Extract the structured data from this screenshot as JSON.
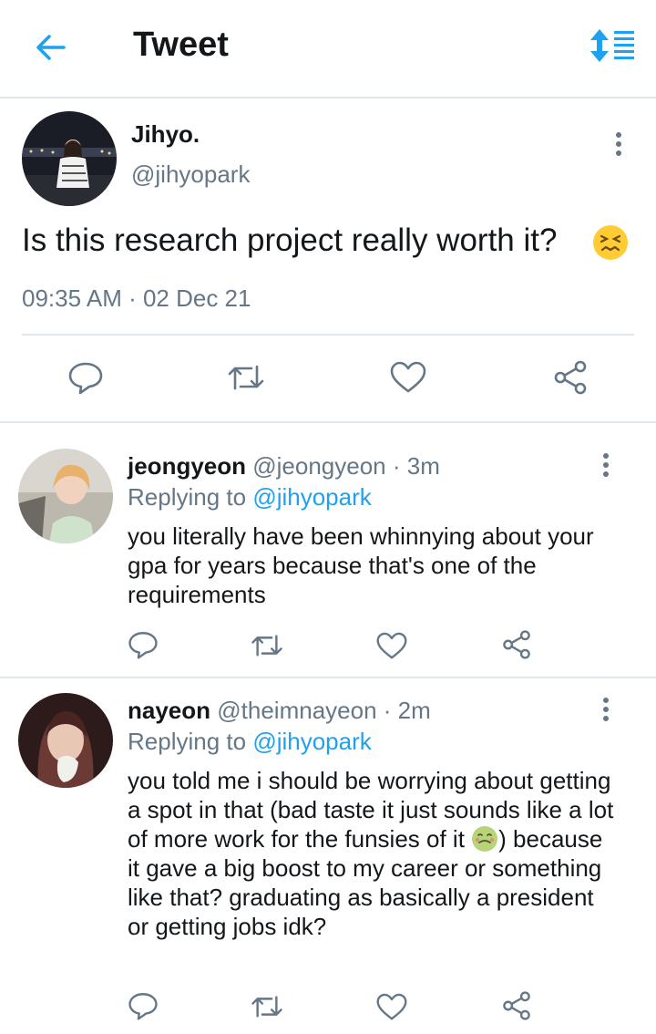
{
  "header": {
    "title": "Tweet",
    "accent_color": "#1da1f2",
    "back_icon": "arrow-left-icon",
    "sort_icon": "sort-list-icon"
  },
  "main_tweet": {
    "name": "Jihyo.",
    "handle": "@jihyopark",
    "text": "Is this research project really worth it?",
    "emoji": "confounded-face-emoji",
    "timestamp": "09:35 AM · 02 Dec 21",
    "actions": [
      "reply-icon",
      "retweet-icon",
      "like-icon",
      "share-icon"
    ]
  },
  "replies": [
    {
      "name": "jeongyeon",
      "handle": "@jeongyeon",
      "time": "· 3m",
      "replying_label": "Replying to",
      "replying_to": "@jihyopark",
      "text": "you literally have been whinnying about your gpa for years because that's one of the requirements"
    },
    {
      "name": "nayeon",
      "handle": "@theimnayeon",
      "time": "· 2m",
      "replying_label": "Replying to",
      "replying_to": "@jihyopark",
      "text_before_emoji": "you told me i should be worrying about getting a spot in that (bad taste it just sounds like a lot of more work for the funsies of it",
      "emoji": "nauseated-face-emoji",
      "text_after_emoji": ") because it gave a big boost to my career or something like that? graduating as basically a president or getting jobs idk?"
    }
  ]
}
